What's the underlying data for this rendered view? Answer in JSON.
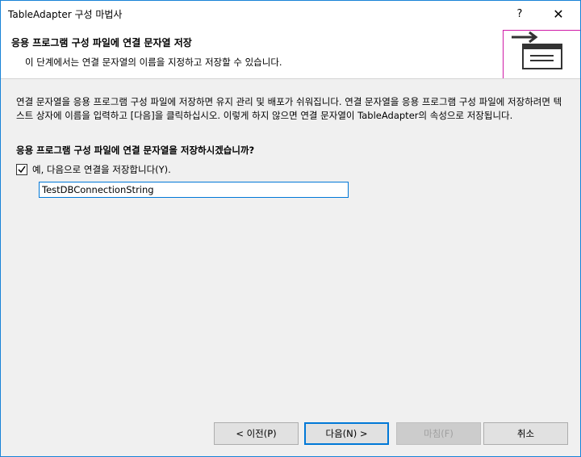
{
  "window": {
    "title": "TableAdapter 구성 마법사",
    "help_label": "?",
    "close_label": "✕"
  },
  "header": {
    "title": "응용 프로그램 구성 파일에 연결 문자열 저장",
    "subtitle": "이 단계에서는 연결 문자열의 이름을 지정하고 저장할 수 있습니다.",
    "icon": "export-arrow-window-icon",
    "icon_accent_color": "#d01aa7"
  },
  "content": {
    "description": "연결 문자열을 응용 프로그램 구성 파일에 저장하면 유지 관리 및 배포가 쉬워집니다. 연결 문자열을 응용 프로그램 구성 파일에 저장하려면 텍스트 상자에 이름을 입력하고 [다음]을 클릭하십시오. 이렇게 하지 않으면 연결 문자열이 TableAdapter의 속성으로 저장됩니다.",
    "question": "응용 프로그램 구성 파일에 연결 문자열을 저장하시겠습니까?",
    "checkbox_label": "예, 다음으로 연결을 저장합니다(Y).",
    "checkbox_checked": true,
    "connection_name": "TestDBConnectionString"
  },
  "buttons": {
    "previous": "< 이전(P)",
    "next": "다음(N) >",
    "finish": "마침(F)",
    "cancel": "취소"
  }
}
